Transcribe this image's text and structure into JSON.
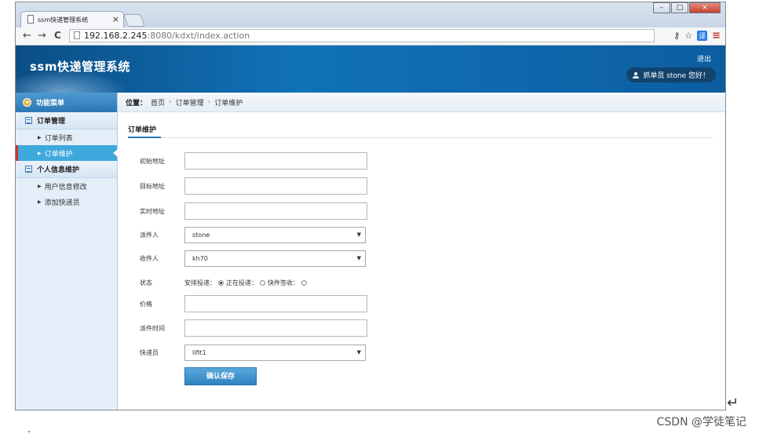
{
  "browser": {
    "tab_title": "ssm快递管理系统",
    "tab_close": "×",
    "url_host": "192.168.2.245",
    "url_path": ":8080/kdxt/index.action",
    "back": "←",
    "forward": "→",
    "reload": "C",
    "key_icon": "⚷",
    "star": "☆",
    "translate": "译",
    "menu": "≡",
    "win_min": "–",
    "win_max": "□",
    "win_close": "×"
  },
  "header": {
    "logo": "ssm快递管理系统",
    "logout": "退出",
    "user_greeting": "抓单员  stone 您好！"
  },
  "sidebar": {
    "title": "功能菜单",
    "groups": [
      {
        "label": "订单管理",
        "items": [
          {
            "label": "订单列表"
          },
          {
            "label": "订单维护"
          }
        ]
      },
      {
        "label": "个人信息维护",
        "items": [
          {
            "label": "用户信息修改"
          },
          {
            "label": "添加快递员"
          }
        ]
      }
    ]
  },
  "breadcrumb": {
    "prefix": "位置：",
    "items": [
      "首页",
      "订单管理",
      "订单维护"
    ],
    "sep": "›"
  },
  "panel": {
    "title": "订单维护"
  },
  "form": {
    "start_address": {
      "label": "初始地址",
      "value": ""
    },
    "target_address": {
      "label": "目标地址",
      "value": ""
    },
    "current_address": {
      "label": "实时地址",
      "value": ""
    },
    "sender": {
      "label": "派件人",
      "value": "stone"
    },
    "receiver": {
      "label": "收件人",
      "value": "kh70"
    },
    "status": {
      "label": "状态",
      "options": [
        {
          "label": "安排投递：",
          "checked": true
        },
        {
          "label": "正在投递：",
          "checked": false
        },
        {
          "label": "快件签收：",
          "checked": false
        }
      ]
    },
    "price": {
      "label": "价格",
      "value": ""
    },
    "dispatch_time": {
      "label": "派件时间",
      "value": ""
    },
    "courier": {
      "label": "快递员",
      "value": "lifit1"
    },
    "select_arrow": "▼",
    "save_label": "确认保存"
  },
  "page": {
    "watermark": "CSDN @学徒笔记",
    "return_glyph": "↵"
  }
}
